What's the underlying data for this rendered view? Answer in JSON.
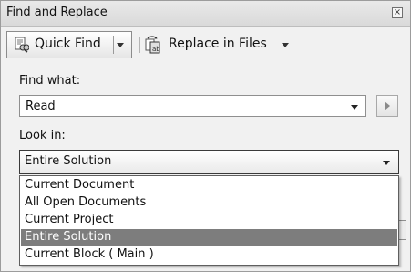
{
  "window": {
    "title": "Find and Replace"
  },
  "toolbar": {
    "quick_find_label": "Quick Find",
    "replace_in_files_label": "Replace in Files"
  },
  "find": {
    "label": "Find what:",
    "value": "Read"
  },
  "look_in": {
    "label": "Look in:",
    "selected": "Entire Solution",
    "options": [
      "Current Document",
      "All Open Documents",
      "Current Project",
      "Entire Solution",
      "Current Block ( Main )"
    ],
    "highlighted_index": 3
  },
  "icons": {
    "quick_find": "binoculars-document-icon",
    "replace_in_files": "replace-files-icon",
    "close": "close-icon",
    "find_next": "play-arrow-icon"
  },
  "colors": {
    "highlight": "#7d7d7d",
    "panel_bg": "#f1f1f1"
  }
}
